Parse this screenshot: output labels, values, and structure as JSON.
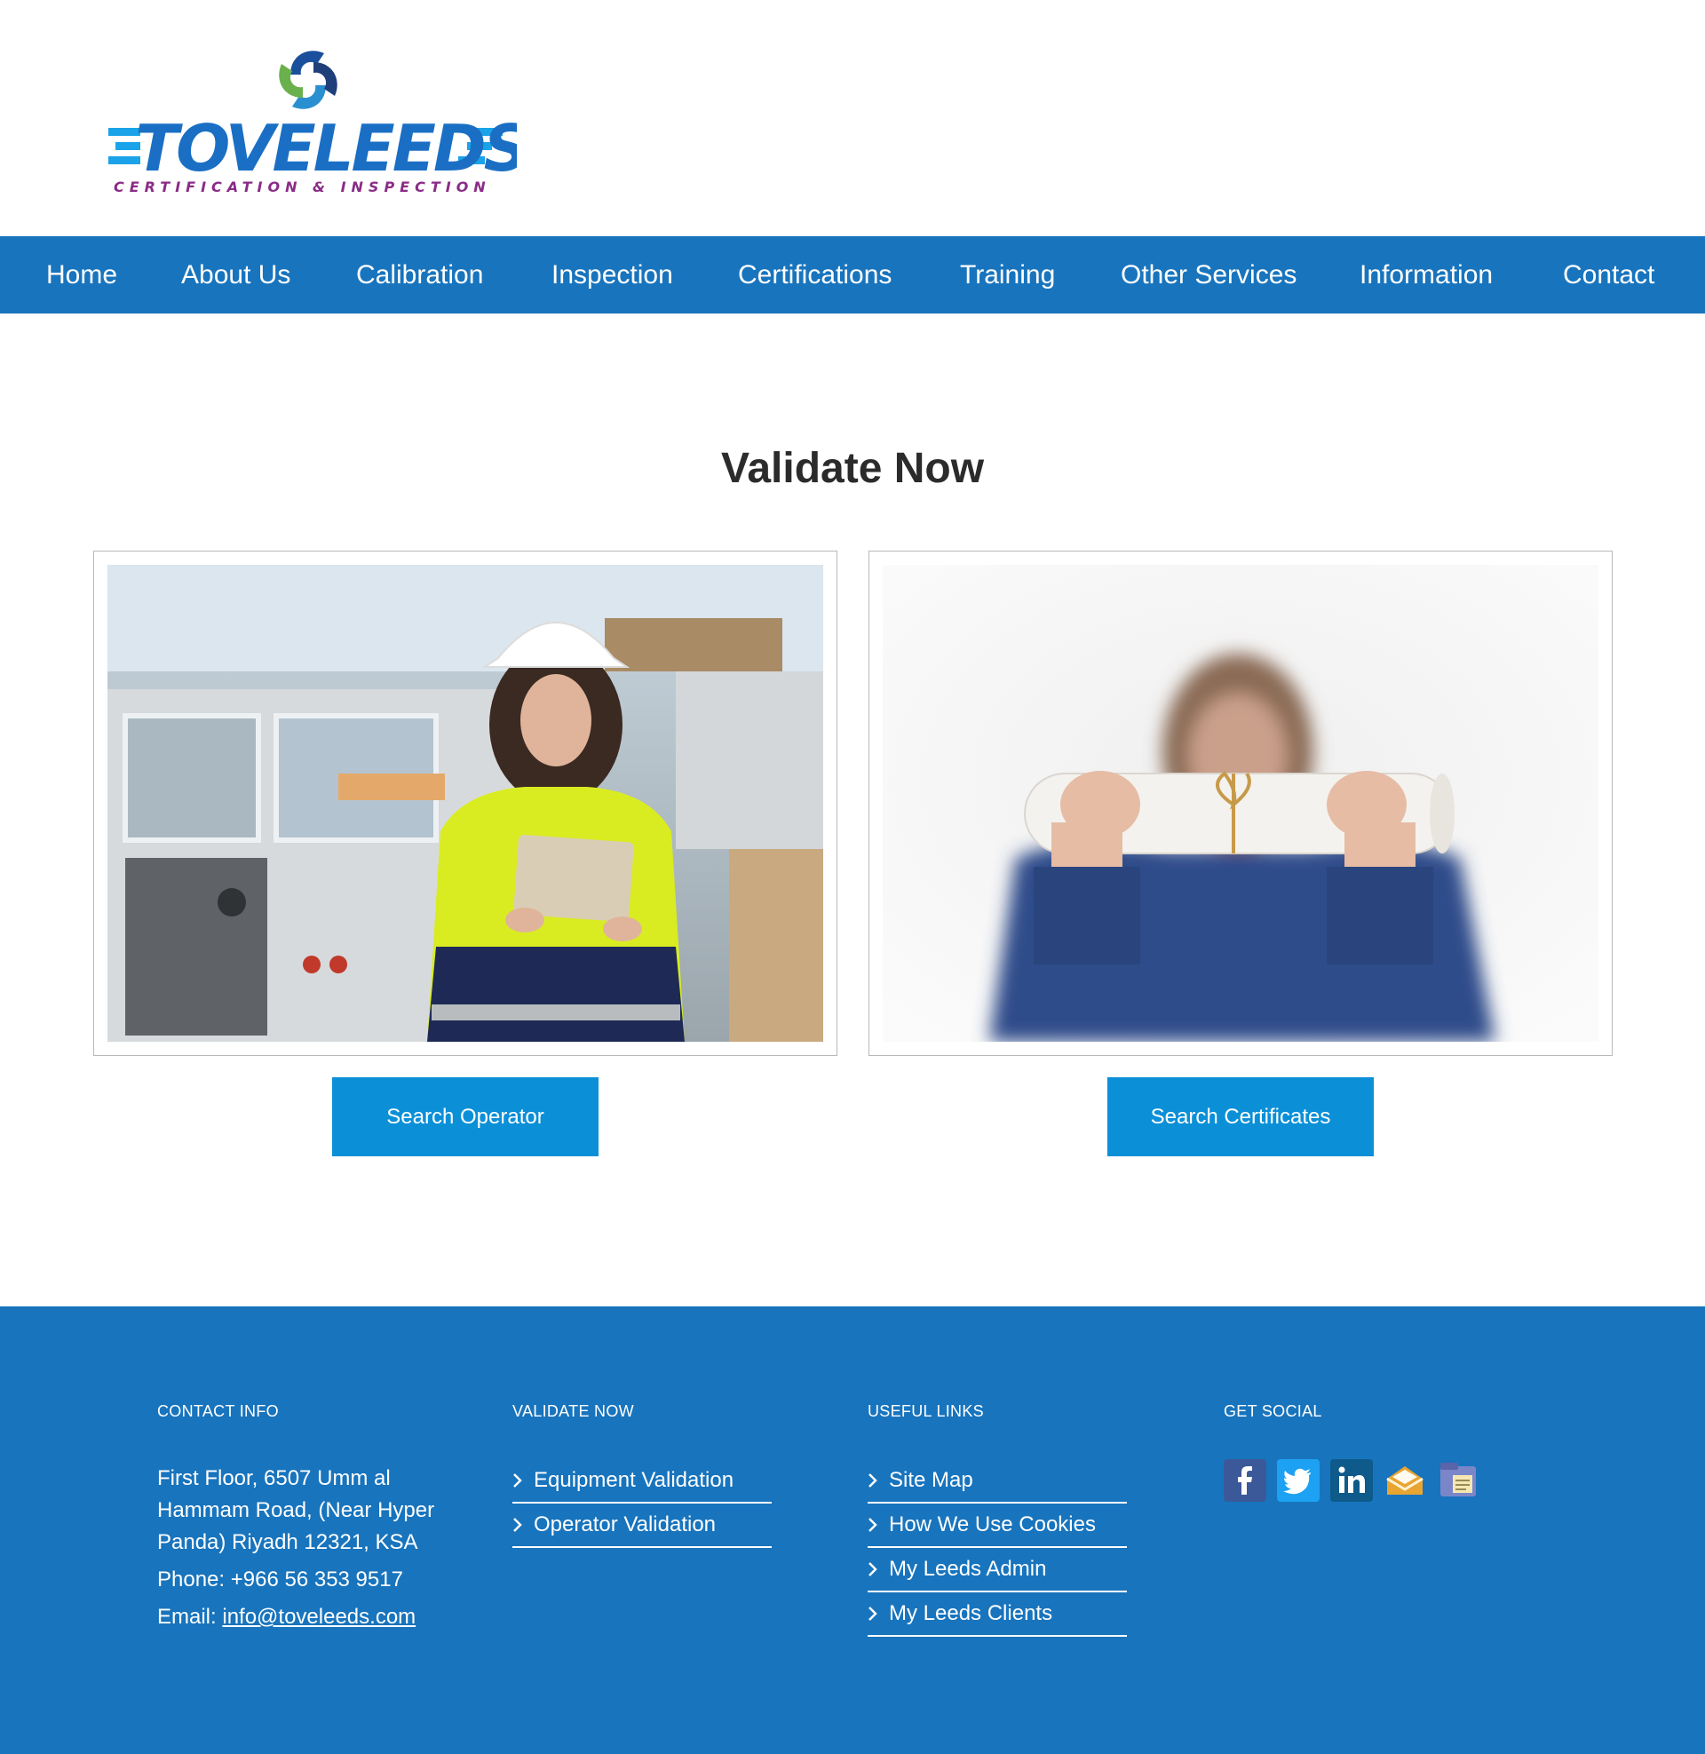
{
  "brand": {
    "name": "TOVELEEDS",
    "tagline": "CERTIFICATION & INSPECTION"
  },
  "nav": [
    {
      "label": "Home"
    },
    {
      "label": "About Us"
    },
    {
      "label": "Calibration"
    },
    {
      "label": "Inspection"
    },
    {
      "label": "Certifications"
    },
    {
      "label": "Training"
    },
    {
      "label": "Other Services"
    },
    {
      "label": "Information"
    },
    {
      "label": "Contact"
    }
  ],
  "main": {
    "title": "Validate Now",
    "cards": [
      {
        "button_label": "Search Operator"
      },
      {
        "button_label": "Search Certificates"
      }
    ]
  },
  "footer": {
    "contact": {
      "title": "CONTACT INFO",
      "address": "First Floor, 6507 Umm al Hammam Road, (Near Hyper Panda) Riyadh 12321, KSA",
      "phone_prefix": "Phone:",
      "phone": "+966 56 353 9517",
      "email_prefix": "Email:",
      "email": "info@toveleeds.com"
    },
    "validate": {
      "title": "VALIDATE NOW",
      "links": [
        "Equipment Validation",
        "Operator Validation"
      ]
    },
    "useful": {
      "title": "USEFUL LINKS",
      "links": [
        "Site Map",
        "How We Use Cookies",
        "My Leeds Admin",
        "My Leeds Clients"
      ]
    },
    "social": {
      "title": "GET SOCIAL",
      "icons": [
        "facebook-icon",
        "twitter-icon",
        "linkedin-icon",
        "email-icon",
        "notes-icon"
      ]
    }
  },
  "colors": {
    "nav_bg": "#1874bd",
    "button_bg": "#0b90d8",
    "footer_bg": "#1874bd"
  }
}
